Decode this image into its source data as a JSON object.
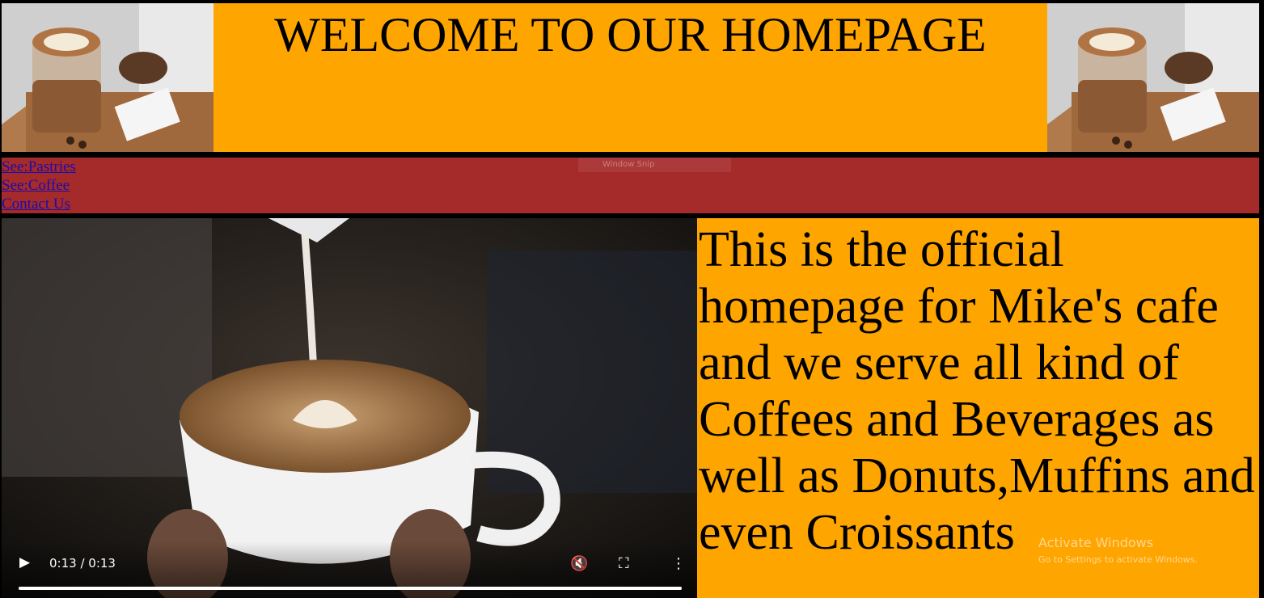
{
  "header": {
    "title": "WELCOME TO OUR HOMEPAGE",
    "left_image": "latte-art-glass-photo",
    "right_image": "latte-art-glass-photo",
    "background": "#ffa500"
  },
  "nav": {
    "background": "#a52a2a",
    "links": [
      {
        "label": "See:Pastries"
      },
      {
        "label": "See:Coffee"
      },
      {
        "label": "Contact Us"
      }
    ]
  },
  "video": {
    "scene": "milk-pouring-latte-art-cup",
    "time_display": "0:13 / 0:13",
    "progress": 1.0,
    "play_icon": "play-icon",
    "mute_icon": "muted-icon",
    "fullscreen_icon": "fullscreen-icon",
    "menu_icon": "more-vertical-icon"
  },
  "info": {
    "text": "This is the official homepage for Mike's cafe and we serve all kind of Coffees and Beverages as well as Donuts,Muffins and even Croissants",
    "background": "#ffa500"
  },
  "overlay": {
    "activate_title": "Activate Windows",
    "activate_sub": "Go to Settings to activate Windows.",
    "snip_label": "Window Snip"
  }
}
